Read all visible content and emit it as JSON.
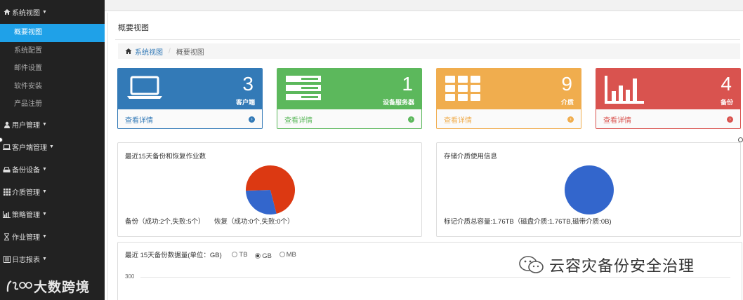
{
  "sidebar": {
    "system_view": "系统视图",
    "subitems": [
      "概要视图",
      "系统配置",
      "邮件设置",
      "软件安装",
      "产品注册"
    ],
    "groups": [
      "用户管理",
      "客户端管理",
      "备份设备",
      "介质管理",
      "策略管理",
      "作业管理",
      "日志报表"
    ],
    "active_color": "#1fa1e8"
  },
  "watermark_left": "大数跨境",
  "page": {
    "title": "概要视图",
    "breadcrumb_home": "系统视图",
    "breadcrumb_current": "概要视图"
  },
  "cards": [
    {
      "count": "3",
      "label": "客户端",
      "link": "查看详情",
      "color": "#337ab7",
      "icon": "laptop-icon"
    },
    {
      "count": "1",
      "label": "设备服务器",
      "link": "查看详情",
      "color": "#5cb85c",
      "icon": "server-icon"
    },
    {
      "count": "9",
      "label": "介质",
      "link": "查看详情",
      "color": "#f0ad4e",
      "icon": "grid-icon"
    },
    {
      "count": "4",
      "label": "备份",
      "link": "查看详情",
      "color": "#d9534f",
      "icon": "bar-chart-icon"
    }
  ],
  "jobs_panel": {
    "title": "最近15天备份和恢复作业数",
    "backup_text": "备份（成功:2个,失败:5个）",
    "restore_text": "恢复（成功:0个,失败:0个）"
  },
  "storage_panel": {
    "title": "存储介质使用信息",
    "summary": "标记介质总容量:1.76TB（磁盘介质:1.76TB,磁带介质:0B)"
  },
  "volume_panel": {
    "title": "最近 15天备份数据量(单位：GB)",
    "units": [
      "TB",
      "GB",
      "MB"
    ],
    "selected_unit": "GB",
    "y_tick": "300"
  },
  "chart_data": [
    {
      "type": "pie",
      "labels": [
        "成功",
        "失败"
      ],
      "values": [
        2,
        5
      ],
      "colors": [
        "#3366cc",
        "#dc3912"
      ]
    },
    {
      "type": "pie",
      "labels": [
        "磁盘介质",
        "磁带介质"
      ],
      "values": [
        1.76,
        0
      ],
      "colors": [
        "#3366cc",
        "#dc3912"
      ]
    }
  ],
  "watermark_right": "云容灾备份安全治理"
}
